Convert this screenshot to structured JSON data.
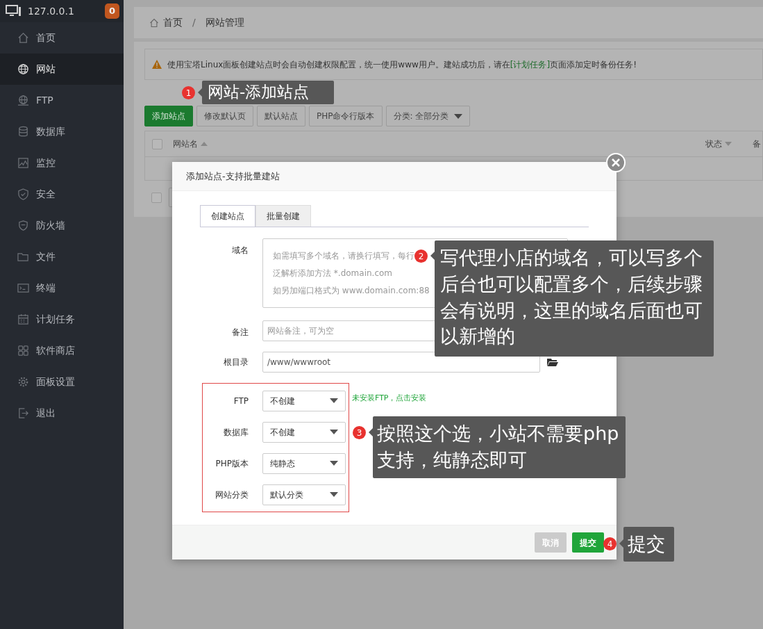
{
  "sidebar": {
    "host": "127.0.0.1",
    "badge": "0",
    "items": [
      {
        "label": "首页",
        "selected": false
      },
      {
        "label": "网站",
        "selected": true
      },
      {
        "label": "FTP",
        "selected": false
      },
      {
        "label": "数据库",
        "selected": false
      },
      {
        "label": "监控",
        "selected": false
      },
      {
        "label": "安全",
        "selected": false
      },
      {
        "label": "防火墙",
        "selected": false
      },
      {
        "label": "文件",
        "selected": false
      },
      {
        "label": "终端",
        "selected": false
      },
      {
        "label": "计划任务",
        "selected": false
      },
      {
        "label": "软件商店",
        "selected": false
      },
      {
        "label": "面板设置",
        "selected": false
      },
      {
        "label": "退出",
        "selected": false
      }
    ]
  },
  "breadcrumb": {
    "items": [
      "首页",
      "网站管理"
    ],
    "separator": "/"
  },
  "notice": {
    "before": "使用宝塔Linux面板创建站点时会自动创建权限配置，统一使用www用户。建站成功后，请在",
    "link": "[计划任务]",
    "after": "页面添加定时备份任务!"
  },
  "toolbar": {
    "buttons": [
      {
        "label": "添加站点",
        "kind": "primary"
      },
      {
        "label": "修改默认页",
        "kind": "default"
      },
      {
        "label": "默认站点",
        "kind": "default"
      },
      {
        "label": "PHP命令行版本",
        "kind": "default"
      }
    ],
    "filter": "分类: 全部分类"
  },
  "table": {
    "columns": [
      "网站名",
      "状态",
      "备"
    ],
    "select_all": {
      "checked": false
    },
    "footer_checkbox": {
      "checked": false
    }
  },
  "modal": {
    "title": "添加站点-支持批量建站",
    "tabs": [
      {
        "label": "创建站点",
        "selected": true
      },
      {
        "label": "批量创建",
        "selected": false
      }
    ],
    "domain": {
      "label": "域名",
      "placeholder": [
        "如需填写多个域名，请换行填写，每行",
        "泛解析添加方法 *.domain.com",
        "如另加端口格式为 www.domain.com:88"
      ]
    },
    "remark": {
      "label": "备注",
      "placeholder": "网站备注，可为空"
    },
    "root": {
      "label": "根目录",
      "value": "/www/wwwroot"
    },
    "selects": [
      {
        "label": "FTP",
        "value": "不创建"
      },
      {
        "label": "数据库",
        "value": "不创建"
      },
      {
        "label": "PHP版本",
        "value": "纯静态"
      },
      {
        "label": "网站分类",
        "value": "默认分类"
      }
    ],
    "ftp_note": "未安装FTP，点击安装",
    "buttons": [
      {
        "label": "取消",
        "kind": "cancel"
      },
      {
        "label": "提交",
        "kind": "submit"
      }
    ]
  },
  "callouts": [
    {
      "number": "1",
      "text": "网站-添加站点"
    },
    {
      "number": "2",
      "text": "写代理小店的域名，可以写多个后台也可以配置多个，后续步骤会有说明，这里的域名后面也可以新增的"
    },
    {
      "number": "3",
      "text": "按照这个选，小站不需要php支持，纯静态即可"
    },
    {
      "number": "4",
      "text": "提交"
    }
  ]
}
